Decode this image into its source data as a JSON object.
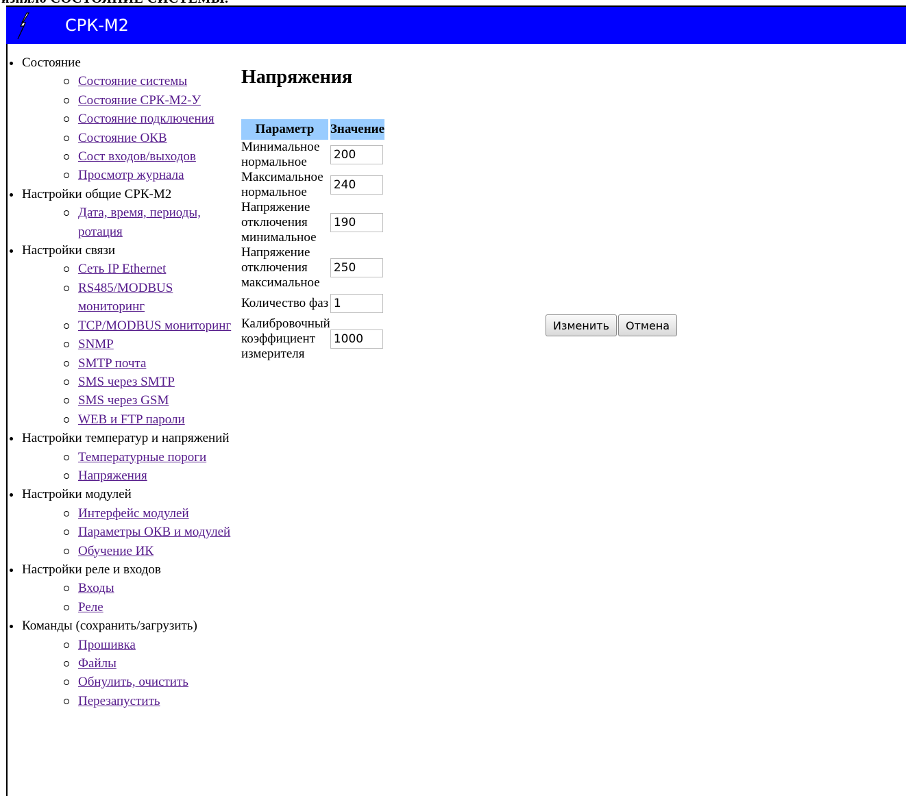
{
  "doc": {
    "cut_text": "изняло СОСТОЯНИЕ СИСТЕМЫ."
  },
  "header": {
    "title": "СРК-М2",
    "background": "#0000ff",
    "logo": "lightning-logo"
  },
  "sidebar": {
    "categories": [
      {
        "label": "Состояние",
        "items": [
          "Состояние системы",
          "Состояние СРК-М2-У",
          "Состояние подключения",
          "Состояние ОКВ",
          "Сост входов/выходов",
          "Просмотр журнала"
        ]
      },
      {
        "label": "Настройки общие СРК-М2",
        "items": [
          "Дата, время, периоды, ротация"
        ]
      },
      {
        "label": "Настройки связи",
        "items": [
          "Сеть IP Ethernet",
          "RS485/MODBUS мониторинг",
          "TCP/MODBUS мониторинг",
          "SNMP",
          "SMTP почта",
          "SMS через SMTP",
          "SMS через GSM",
          "WEB и FTP пароли"
        ]
      },
      {
        "label": "Настройки температур и напряжений",
        "items": [
          "Температурные пороги",
          "Напряжения"
        ]
      },
      {
        "label": "Настройки модулей",
        "items": [
          "Интерфейс модулей",
          "Параметры ОКВ и модулей",
          "Обучение ИК"
        ]
      },
      {
        "label": "Настройки реле и входов",
        "items": [
          "Входы",
          "Реле"
        ]
      },
      {
        "label": "Команды (сохранить/загрузить)",
        "items": [
          "Прошивка",
          "Файлы",
          "Обнулить, очистить",
          "Перезапустить"
        ]
      }
    ]
  },
  "main": {
    "title": "Напряжения",
    "table": {
      "headers": [
        "Параметр",
        "Значение"
      ],
      "header_color": "#99ccff",
      "rows": [
        {
          "label": "Минимальное нормальное",
          "value": "200"
        },
        {
          "label": "Максимальное нормальное",
          "value": "240"
        },
        {
          "label": "Напряжение отключения минимальное",
          "value": "190"
        },
        {
          "label": "Напряжение отключения максимальное",
          "value": "250"
        },
        {
          "label": "Количество фаз",
          "value": "1"
        },
        {
          "label": "Калибровочный коэффициент измерителя",
          "value": "1000"
        }
      ]
    },
    "buttons": {
      "submit": "Изменить",
      "cancel": "Отмена"
    }
  }
}
